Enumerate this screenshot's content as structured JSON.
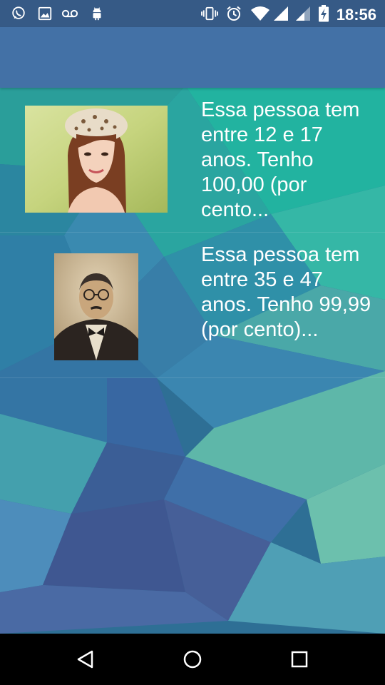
{
  "status_bar": {
    "time": "18:56",
    "left_icons": [
      "whatsapp-icon",
      "image-icon",
      "voicemail-icon",
      "android-icon"
    ],
    "right_icons": [
      "vibrate-icon",
      "alarm-icon",
      "wifi-icon",
      "signal-icon",
      "signal-icon",
      "battery-charging-icon"
    ]
  },
  "app_bar": {
    "title": ""
  },
  "results": [
    {
      "text": "Essa pessoa tem entre 12 e 17 anos. Tenho 100,00 (por cento...",
      "photo": "young-woman-photo"
    },
    {
      "text": "Essa pessoa tem entre 35 e 47 anos. Tenho 99,99 (por cento)...",
      "photo": "old-man-portrait-photo"
    }
  ],
  "nav_bar": {
    "icons": [
      "back-icon",
      "home-icon",
      "recents-icon"
    ]
  },
  "colors": {
    "status_bar": "#365a86",
    "app_bar": "#4371a6",
    "nav_bar": "#000000",
    "text": "#ffffff"
  }
}
